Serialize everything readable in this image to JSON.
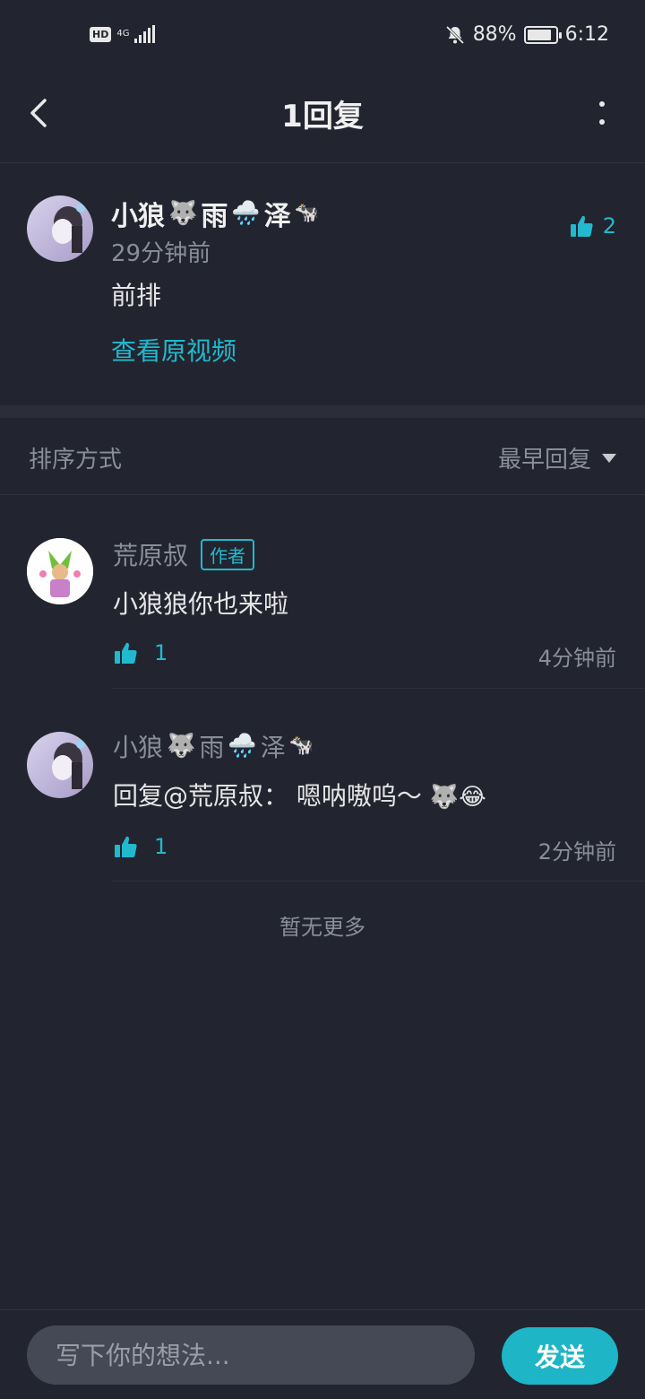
{
  "status_bar": {
    "hd": "HD",
    "network": "4G",
    "battery_percent": "88%",
    "battery_level": 0.88,
    "time": "6:12",
    "icons": [
      "hd-icon",
      "signal-icon",
      "mute-bell-icon",
      "battery-icon"
    ]
  },
  "header": {
    "title": "1回复",
    "icons": [
      "back-arrow-icon",
      "more-vertical-icon"
    ]
  },
  "main_comment": {
    "user_parts": [
      "小狼",
      "🐺",
      "雨",
      "🌧️",
      "泽",
      "🐄"
    ],
    "time": "29分钟前",
    "text": "前排",
    "like_count": "2",
    "view_video_label": "查看原视频"
  },
  "sort": {
    "label": "排序方式",
    "selected": "最早回复"
  },
  "replies": [
    {
      "user": "荒原叔",
      "tag": "作者",
      "text": "小狼狼你也来啦",
      "like_count": "1",
      "time": "4分钟前"
    },
    {
      "user_parts": [
        "小狼",
        "🐺",
        "雨",
        "🌧️",
        "泽",
        "🐄"
      ],
      "text_prefix": "回复@荒原叔：",
      "text_body": "嗯呐嗷呜～",
      "text_emoji": "🐺😂",
      "like_count": "1",
      "time": "2分钟前"
    }
  ],
  "footer_text": "暂无更多",
  "composer": {
    "placeholder": "写下你的想法...",
    "send_label": "发送"
  },
  "colors": {
    "background": "#22252f",
    "accent": "#22b9cf",
    "send_button": "#1eb5c6",
    "muted_text": "#8a8e98"
  }
}
